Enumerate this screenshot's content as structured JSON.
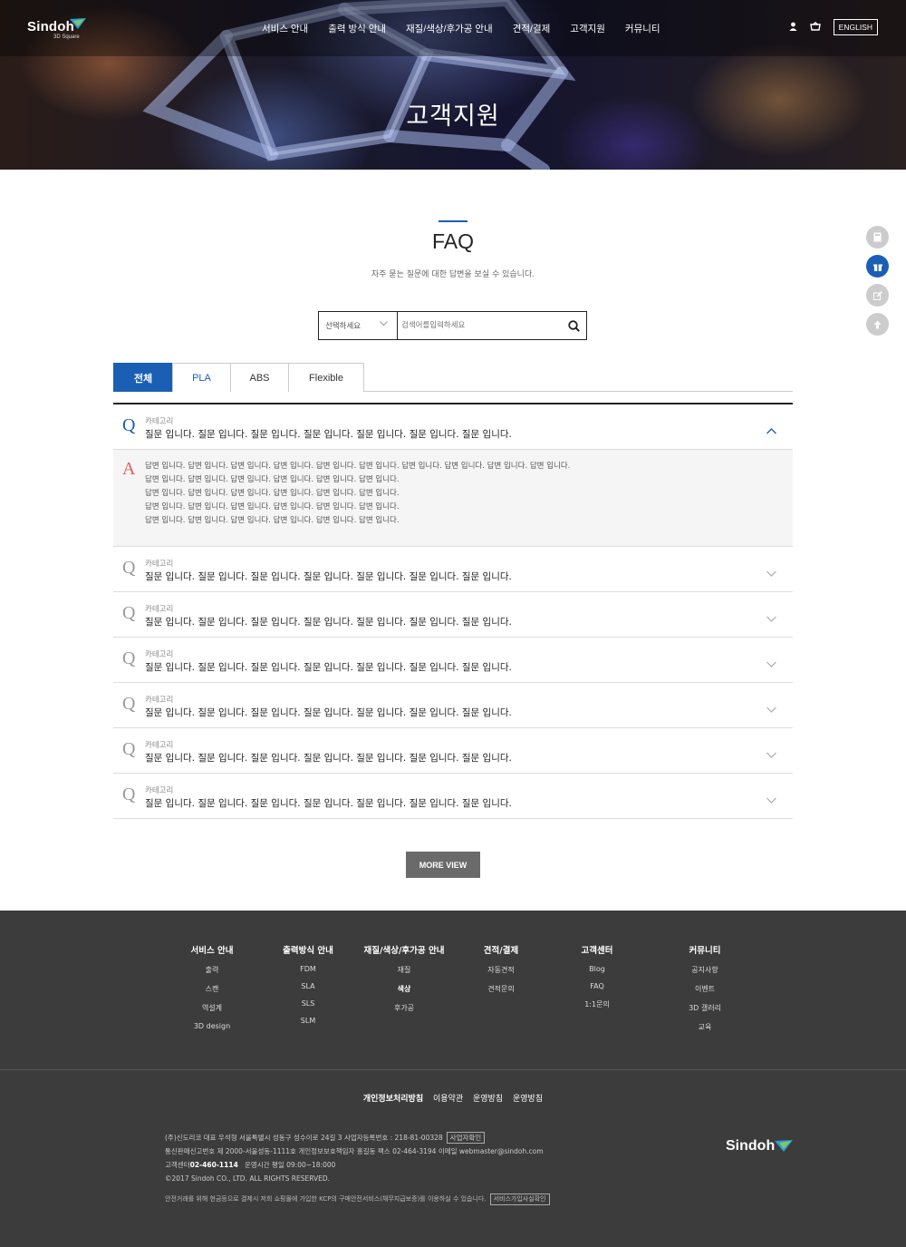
{
  "header": {
    "logo": "Sindoh",
    "logo_sub": "3D Square",
    "nav": [
      "서비스 안내",
      "출력 방식 안내",
      "재질/색상/후가공 안내",
      "견적/결제",
      "고객지원",
      "커뮤니티"
    ],
    "lang_button": "ENGLISH",
    "icons": [
      "user-icon",
      "cart-icon"
    ]
  },
  "hero": {
    "title": "고객지원"
  },
  "section": {
    "title": "FAQ",
    "description": "자주 묻는 질문에 대한 답변을 보실 수 있습니다."
  },
  "search": {
    "select_label": "선택하세요",
    "placeholder": "검색어를입력하세요",
    "button_icon": "search-icon"
  },
  "tabs": [
    "전체",
    "PLA",
    "ABS",
    "Flexible"
  ],
  "faq": {
    "q_letter": "Q",
    "a_letter": "A",
    "items": [
      {
        "category": "카테고리",
        "question": "질문 입니다. 질문 입니다. 질문 입니다. 질문 입니다. 질문 입니다. 질문 입니다. 질문 입니다.",
        "open": true
      },
      {
        "category": "카테고리",
        "question": "질문 입니다. 질문 입니다. 질문 입니다. 질문 입니다. 질문 입니다. 질문 입니다. 질문 입니다."
      },
      {
        "category": "카테고리",
        "question": "질문 입니다. 질문 입니다. 질문 입니다. 질문 입니다. 질문 입니다. 질문 입니다. 질문 입니다."
      },
      {
        "category": "카테고리",
        "question": "질문 입니다. 질문 입니다. 질문 입니다. 질문 입니다. 질문 입니다. 질문 입니다. 질문 입니다."
      },
      {
        "category": "카테고리",
        "question": "질문 입니다. 질문 입니다. 질문 입니다. 질문 입니다. 질문 입니다. 질문 입니다. 질문 입니다."
      },
      {
        "category": "카테고리",
        "question": "질문 입니다. 질문 입니다. 질문 입니다. 질문 입니다. 질문 입니다. 질문 입니다. 질문 입니다."
      },
      {
        "category": "카테고리",
        "question": "질문 입니다. 질문 입니다. 질문 입니다. 질문 입니다. 질문 입니다. 질문 입니다. 질문 입니다."
      }
    ],
    "answer_lines": [
      "답변 입니다.  답변 입니다.  답변 입니다.  답변 입니다.  답변 입니다.  답변 입니다.  답변 입니다.  답변 입니다.  답변 입니다.  답변 입니다.",
      "답변 입니다.  답변 입니다.  답변 입니다.  답변 입니다.  답변 입니다.  답변 입니다.",
      "답변 입니다.  답변 입니다.  답변 입니다.  답변 입니다.  답변 입니다.  답변 입니다.",
      "답변 입니다.  답변 입니다.  답변 입니다.  답변 입니다.  답변 입니다.  답변 입니다.",
      "답변 입니다.  답변 입니다.  답변 입니다.  답변 입니다.  답변 입니다.  답변 입니다."
    ]
  },
  "more_button": "MORE VIEW",
  "side_quick": [
    "calculator-icon",
    "gift-icon",
    "edit-icon",
    "arrow-up-icon"
  ],
  "footer": {
    "columns": [
      {
        "title": "서비스 안내",
        "items": [
          "출력",
          "스캔",
          "역설계",
          "3D design"
        ]
      },
      {
        "title": "출력방식 안내",
        "items": [
          "FDM",
          "SLA",
          "SLS",
          "SLM"
        ]
      },
      {
        "title": "재질/색상/후가공 안내",
        "items": [
          "재질",
          "색상",
          "후가공"
        ]
      },
      {
        "title": "견적/결제",
        "items": [
          "자동견적",
          "견적문의"
        ]
      },
      {
        "title": "고객센터",
        "items": [
          "Blog",
          "FAQ",
          "1:1문의"
        ]
      },
      {
        "title": "커뮤니티",
        "items": [
          "공지사항",
          "이벤트",
          "3D 갤러리",
          "교육"
        ]
      }
    ],
    "links": [
      "개인정보처리방침",
      "이용약관",
      "운영방침",
      "운영방침"
    ],
    "info": {
      "line1": "(주)신도리코   대표 우석형   서울특별시 성동구 성수이로 24길 3   사업자등록번호 : 218-81-00328",
      "line1_box": "사업자확인",
      "line2": "통신판매신고번호 제 2000-서울성동-1111호   개인정보보호책임자 홍길동   팩스 02-464-3194   이메일 webmaster@sindoh.com",
      "line3_label": "고객센터",
      "line3_phone": "02-460-1114",
      "line3_hours": "운영시간 평일 09:00~18:000",
      "line4": "©2017 Sindoh CO., LTD. ALL RIGHTS RESERVED."
    },
    "note": "안전거래를 위해 현금등으로 결제시 저희 쇼핑몰에 가입한 KCP의 구매안전서비스(채무지급보증)를 이용하실 수 있습니다.",
    "note_box": "서비스가입사실확인",
    "logo": "Sindoh"
  },
  "colors": {
    "accent": "#1a5fb4",
    "answer_letter": "#e06060",
    "footer_bg": "#3c3c3c"
  }
}
